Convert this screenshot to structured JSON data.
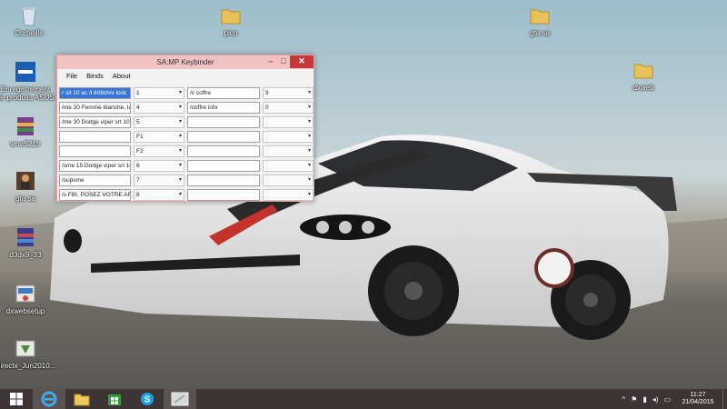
{
  "desktop": {
    "icons": [
      {
        "label": "Corbeille"
      },
      {
        "label": "Enregistrement de produits ASUS"
      },
      {
        "label": "wrar521fr"
      },
      {
        "label": "gta sa"
      },
      {
        "label": "d3dx9_33"
      },
      {
        "label": "dxwebsetup"
      },
      {
        "label": "directx_Jun2010..."
      },
      {
        "label": "pico"
      },
      {
        "label": "gta sa"
      },
      {
        "label": "dxweb"
      }
    ]
  },
  "window": {
    "title": "SA:MP Keybinder",
    "minimize": "–",
    "maximize": "□",
    "close": "✕",
    "menu": [
      "File",
      "Binds",
      "About"
    ],
    "rows": [
      {
        "bind": "r sit 10 ac /l 608ch/v lock",
        "key": "1",
        "bind2": "/v coffre",
        "key2": "9",
        "selected": true
      },
      {
        "bind": "/me 30 Femme blanche, la",
        "key": "4",
        "bind2": "/coffre info",
        "key2": "0",
        "selected": false
      },
      {
        "bind": "/me 30 Dodge viper srt 10 -",
        "key": "5",
        "bind2": "",
        "key2": "",
        "selected": false
      },
      {
        "bind": "",
        "key": "F1",
        "bind2": "",
        "key2": "",
        "selected": false
      },
      {
        "bind": "",
        "key": "F2",
        "bind2": "",
        "key2": "",
        "selected": false
      },
      {
        "bind": "/sme 15 Dodge viper srt 10",
        "key": "6",
        "bind2": "",
        "key2": "",
        "selected": false
      },
      {
        "bind": "/supsme",
        "key": "7",
        "bind2": "",
        "key2": "",
        "selected": false
      },
      {
        "bind": "/s FBI, POSEZ VOTRE AR",
        "key": "8",
        "bind2": "",
        "key2": "",
        "selected": false
      }
    ],
    "dropdown_arrow": "▾"
  },
  "taskbar": {
    "start": "windows-start",
    "apps": [
      "internet-explorer",
      "file-explorer",
      "store",
      "skype",
      "keybinder"
    ],
    "tray": {
      "up": "^",
      "flag": "⚑",
      "network": "▮",
      "volume": "◂)",
      "keyboard": "▭"
    },
    "time": "11:27",
    "date": "21/04/2015"
  }
}
